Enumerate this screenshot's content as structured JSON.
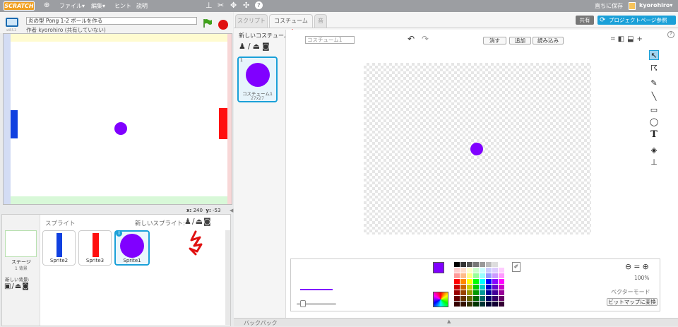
{
  "menubar": {
    "logo": "SCRATCH",
    "file": "ファイル▾",
    "edit": "編集▾",
    "hint": "ヒント",
    "about": "説明",
    "save_now": "直ちに保存",
    "user": "kyorohiro▾"
  },
  "project": {
    "title": "炎の型 Pong 1-2 ボールを作る",
    "author": "作者 kyorohiro (共有していない)",
    "version": "v455.3"
  },
  "stage": {
    "x_label": "x:",
    "x": "240",
    "y_label": "y:",
    "y": "-53"
  },
  "sprites": {
    "header": "スプライト",
    "new_sprite": "新しいスプライト:",
    "items": [
      "Sprite2",
      "Sprite3",
      "Sprite1"
    ],
    "stage_label": "ステージ",
    "stage_sub": "1 背景",
    "new_backdrop": "新しい背景:"
  },
  "editor": {
    "tabs": [
      "スクリプト",
      "コスチューム",
      "音"
    ],
    "share": "共有",
    "see_page": "プロジェクトページ参照",
    "new_costume": "新しいコスチューム:",
    "costume_name": "コスチューム1",
    "costume_label": "コスチューム1",
    "costume_size": "27x27",
    "clear": "消す",
    "add": "追加",
    "import": "読み込み",
    "zoom": "100%",
    "mode": "ベクターモード",
    "convert": "ビットマップに変換",
    "backpack": "バックパック"
  },
  "colors": {
    "accent": "#1aa0d8",
    "ball": "#8000ff",
    "paddle_left": "#1040e0",
    "paddle_right": "#ff1010"
  }
}
